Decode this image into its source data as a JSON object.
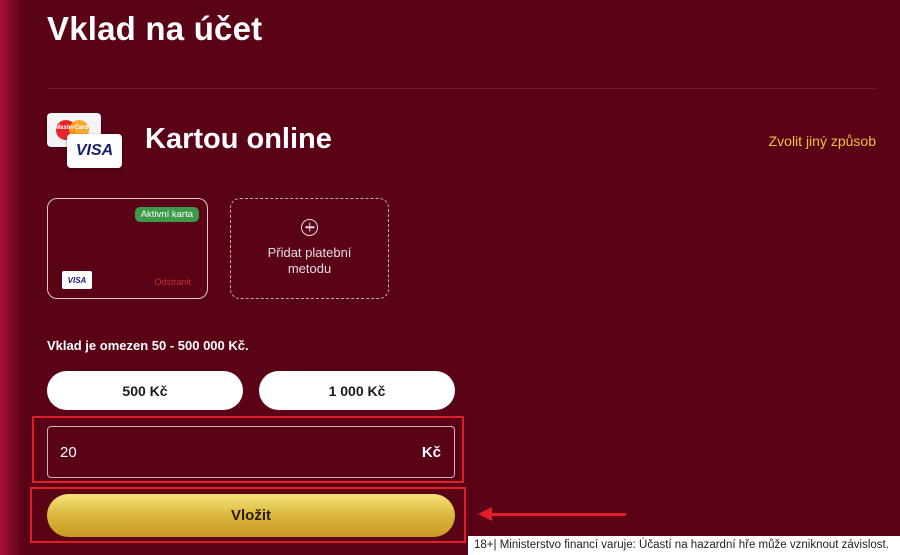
{
  "header": {
    "title": "Vklad na účet"
  },
  "method": {
    "title": "Kartou online",
    "change_label": "Zvolit jiný způsob",
    "logos": {
      "mastercard_text": "MasterCard",
      "visa_text": "VISA"
    }
  },
  "saved_card": {
    "badge": "Aktivní karta",
    "brand": "VISA",
    "remove_label": "Odstranit"
  },
  "add_method": {
    "icon": "plus-circle-icon",
    "label": "Přidat platební metodu"
  },
  "limit": {
    "text": "Vklad je omezen 50 - 500 000 Kč."
  },
  "presets": [
    {
      "label": "500 Kč"
    },
    {
      "label": "1 000 Kč"
    }
  ],
  "amount": {
    "value": "20",
    "currency": "Kč"
  },
  "submit": {
    "label": "Vložit"
  },
  "footer": {
    "warning": "18+| Ministerstvo financí varuje: Účastí na hazardní hře může vzniknout závislost."
  },
  "colors": {
    "background": "#5a0216",
    "accent_gold": "#f2c13c",
    "annotation_red": "#e11d2a",
    "badge_green": "#3c9a4a"
  }
}
